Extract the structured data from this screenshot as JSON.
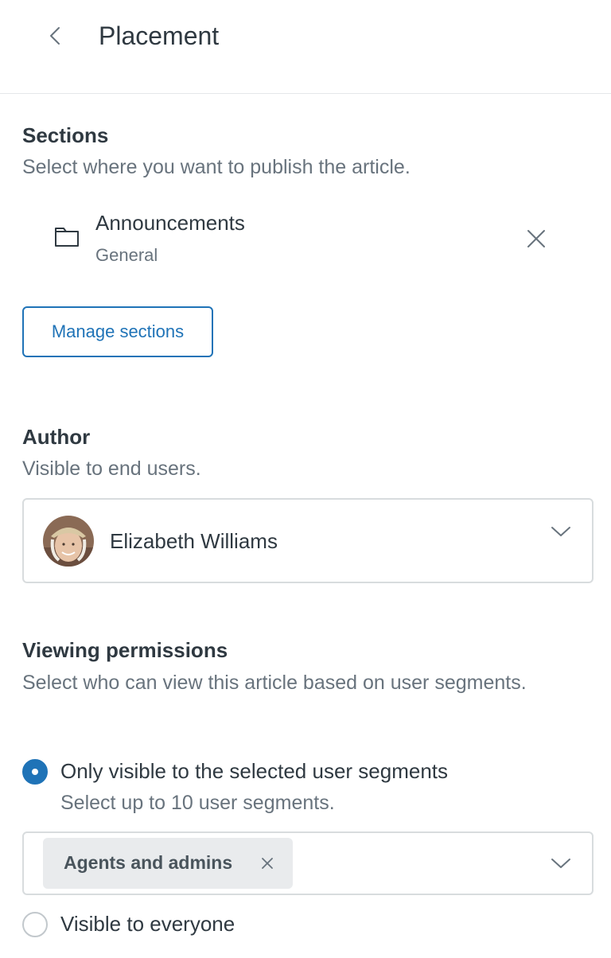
{
  "header": {
    "title": "Placement"
  },
  "sections": {
    "title": "Sections",
    "description": "Select where you want to publish the article.",
    "items": [
      {
        "name": "Announcements",
        "category": "General"
      }
    ],
    "manage_label": "Manage sections"
  },
  "author": {
    "title": "Author",
    "description": "Visible to end users.",
    "selected": "Elizabeth Williams"
  },
  "permissions": {
    "title": "Viewing permissions",
    "description": "Select who can view this article based on user segments.",
    "options": [
      {
        "label": "Only visible to the selected user segments",
        "sublabel": "Select up to 10 user segments.",
        "checked": true
      },
      {
        "label": "Visible to everyone",
        "checked": false
      }
    ],
    "segments": [
      "Agents and admins"
    ]
  },
  "icons": {
    "back": "chevron-left-icon",
    "folder": "folder-icon",
    "remove": "close-icon",
    "dropdown": "chevron-down-icon"
  },
  "colors": {
    "accent": "#1f73b7",
    "text": "#2f3941",
    "muted": "#68737d",
    "border": "#d8dcde",
    "tag_bg": "#e9ebed"
  }
}
